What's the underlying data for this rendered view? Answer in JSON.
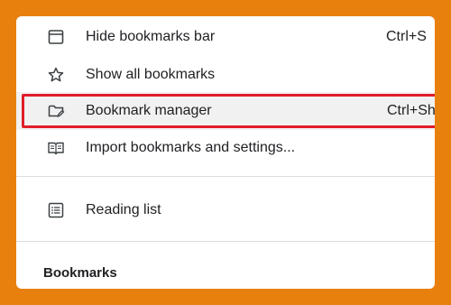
{
  "menu": {
    "items": [
      {
        "label": "Hide bookmarks bar",
        "shortcut": "Ctrl+S",
        "icon": "bookmarks-bar-icon"
      },
      {
        "label": "Show all bookmarks",
        "shortcut": "",
        "icon": "star-icon"
      },
      {
        "label": "Bookmark manager",
        "shortcut": "Ctrl+Sh",
        "icon": "folder-edit-icon",
        "highlighted": true
      },
      {
        "label": "Import bookmarks and settings...",
        "shortcut": "",
        "icon": "import-book-icon"
      },
      {
        "label": "Reading list",
        "shortcut": "",
        "icon": "reading-list-icon"
      }
    ],
    "section_heading": "Bookmarks"
  },
  "colors": {
    "background": "#e8800e",
    "panel": "#ffffff",
    "highlight_border": "#e11d2a",
    "text": "#202124"
  }
}
